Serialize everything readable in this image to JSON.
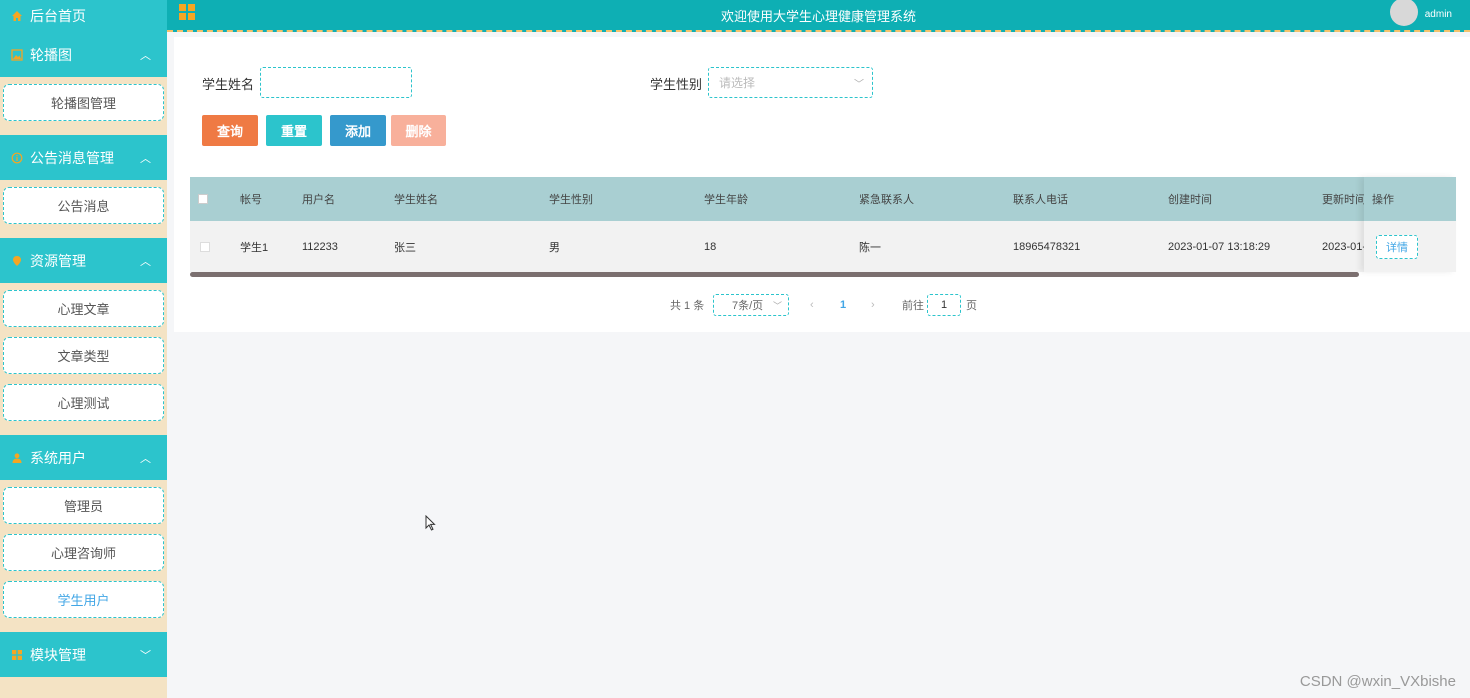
{
  "sidebar": {
    "home": {
      "label": "后台首页",
      "icon": "home-icon"
    },
    "groups": [
      {
        "label": "轮播图",
        "icon": "image-icon",
        "expanded": true,
        "items": [
          {
            "label": "轮播图管理"
          }
        ]
      },
      {
        "label": "公告消息管理",
        "icon": "info-icon",
        "expanded": true,
        "items": [
          {
            "label": "公告消息"
          }
        ]
      },
      {
        "label": "资源管理",
        "icon": "location-icon",
        "expanded": true,
        "items": [
          {
            "label": "心理文章"
          },
          {
            "label": "文章类型"
          },
          {
            "label": "心理测试"
          }
        ]
      },
      {
        "label": "系统用户",
        "icon": "user-icon",
        "expanded": true,
        "items": [
          {
            "label": "管理员"
          },
          {
            "label": "心理咨询师"
          },
          {
            "label": "学生用户",
            "active": true
          }
        ]
      },
      {
        "label": "模块管理",
        "icon": "grid-icon",
        "expanded": false,
        "items": []
      }
    ]
  },
  "topbar": {
    "title": "欢迎使用大学生心理健康管理系统",
    "username": "admin",
    "menu_icon": "grid-icon"
  },
  "search": {
    "name_label": "学生姓名",
    "name_value": "",
    "gender_label": "学生性别",
    "gender_placeholder": "请选择"
  },
  "buttons": {
    "query": "查询",
    "reset": "重置",
    "add": "添加",
    "delete": "删除"
  },
  "table": {
    "columns": [
      "帐号",
      "用户名",
      "学生姓名",
      "学生性别",
      "学生年龄",
      "紧急联系人",
      "联系人电话",
      "创建时间",
      "更新时间",
      "操作"
    ],
    "rows": [
      {
        "account": "学生1",
        "username": "112233",
        "name": "张三",
        "gender": "男",
        "age": "18",
        "contact": "陈一",
        "phone": "18965478321",
        "created": "2023-01-07 13:18:29",
        "updated": "2023-01-",
        "action": "详情"
      }
    ]
  },
  "pagination": {
    "total": "共 1 条",
    "page_size": "7条/页",
    "current_page": "1",
    "goto_prefix": "前往",
    "goto_value": "1",
    "goto_suffix": "页"
  },
  "watermark": "CSDN @wxin_VXbishe",
  "colors": {
    "primary": "#2cc4cc",
    "topbar": "#0eafb4",
    "sidebar_bg": "#f4e3c4",
    "query": "#ef7a44",
    "add": "#3599cc",
    "delete": "#f8b09b",
    "table_header": "#a9cfd2"
  }
}
